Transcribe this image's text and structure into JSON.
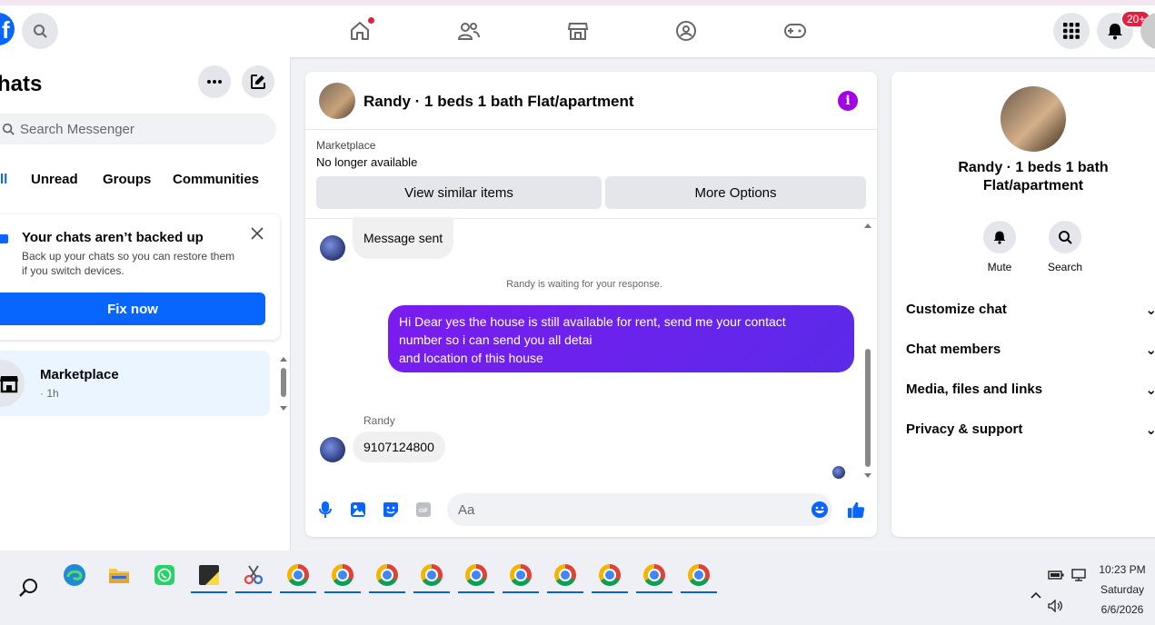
{
  "topnav": {
    "logo": "f",
    "notification_badge": "20+"
  },
  "sidebar": {
    "title": "hats",
    "search_placeholder": "Search Messenger",
    "filters": [
      "ll",
      "Unread",
      "Groups",
      "Communities"
    ],
    "backup_card": {
      "title": "Your chats aren’t backed up",
      "text": "Back up your chats so you can restore them if you switch devices.",
      "button": "Fix now"
    },
    "chat_item": {
      "name": "Marketplace",
      "time": "· 1h"
    }
  },
  "conversation": {
    "title": "Randy · 1 beds 1 bath Flat/apartment",
    "marketplace_label": "Marketplace",
    "marketplace_status": "No longer available",
    "btn_view_similar": "View similar items",
    "btn_more_options": "More Options",
    "messages": {
      "msg1": "Message sent",
      "system": "Randy is waiting for your response.",
      "out_line1": "Hi Dear yes the house is still available for rent, send me your contact",
      "out_line2": "number so i can send you all detai",
      "out_line3": "and location of this house",
      "sender": "Randy",
      "msg_phone": "9107124800"
    },
    "composer_placeholder": "Aa",
    "gif_label": "GIF"
  },
  "right_panel": {
    "name_line1": "Randy · 1 beds 1 bath",
    "name_line2": "Flat/apartment",
    "mute_label": "Mute",
    "search_label": "Search",
    "rows": [
      "Customize chat",
      "Chat members",
      "Media, files and links",
      "Privacy & support"
    ]
  },
  "taskbar": {
    "time": "10:23 PM",
    "day": "Saturday",
    "date": "6/6/2026"
  },
  "colors": {
    "brand_blue": "#0866ff",
    "accent_purple": "#a301e8",
    "outgoing_bubble": "#6b22ee"
  }
}
